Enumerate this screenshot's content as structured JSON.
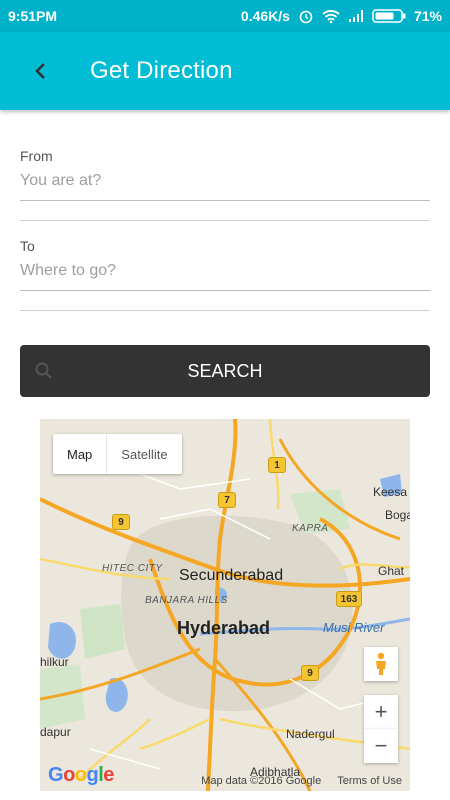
{
  "status_bar": {
    "time": "9:51PM",
    "network_speed": "0.46K/s",
    "battery": "71%"
  },
  "app_bar": {
    "title": "Get Direction",
    "back_icon": "chevron-left-icon"
  },
  "form": {
    "from": {
      "label": "From",
      "placeholder": "You are at?"
    },
    "to": {
      "label": "To",
      "placeholder": "Where to go?"
    },
    "search_label": "SEARCH"
  },
  "map": {
    "type_controls": {
      "map": "Map",
      "satellite": "Satellite"
    },
    "labels": {
      "keesara": "Keesa",
      "bogaram": "Boga",
      "kapra": "KAPRA",
      "hitec_city": "HITEC CITY",
      "secunderabad": "Secunderabad",
      "ghatkesar": "Ghat",
      "banjara_hills": "BANJARA HILLS",
      "hyderabad": "Hyderabad",
      "musi_river": "Musi River",
      "shamshabad": "hilkur",
      "nadergul": "Nadergul",
      "rajendranagar": "dapur",
      "adibhatla": "Adibhatla"
    },
    "shields": {
      "nh1": "1",
      "r7": "7",
      "r9a": "9",
      "r163": "163",
      "r9b": "9"
    },
    "zoom_in": "+",
    "zoom_out": "−",
    "logo": "Google",
    "attribution": "Map data ©2016 Google",
    "terms": "Terms of Use"
  },
  "colors": {
    "primary": "#00bcd4",
    "status": "#00b2c9",
    "button": "#333333"
  }
}
